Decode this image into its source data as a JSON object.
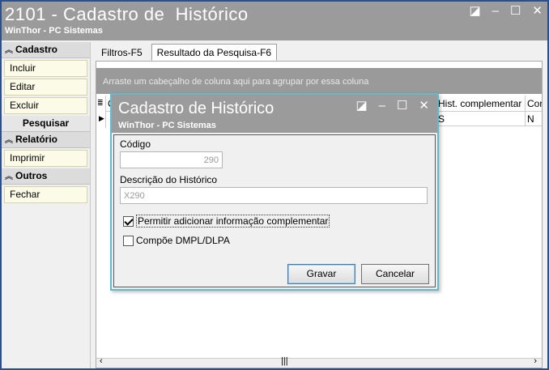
{
  "window": {
    "title": "2101 - Cadastro de  Histórico",
    "subtitle": "WinThor - PC Sistemas"
  },
  "sidebar": {
    "groups": [
      {
        "label": "Cadastro",
        "items": [
          "Incluir",
          "Editar",
          "Excluir"
        ]
      },
      {
        "label": "Pesquisar",
        "items": []
      },
      {
        "label": "Relatório",
        "items": [
          "Imprimir"
        ]
      },
      {
        "label": "Outros",
        "items": [
          "Fechar"
        ]
      }
    ]
  },
  "tabs": [
    "Filtros-F5",
    "Resultado da Pesquisa-F6"
  ],
  "grid": {
    "group_hint": "Arraste um cabeçalho de coluna aqui para agrupar por essa coluna",
    "columns": [
      "C",
      "Hist. complementar",
      "Cor"
    ],
    "row": [
      "",
      "S",
      "N"
    ]
  },
  "dialog": {
    "title": "Cadastro de Histórico",
    "subtitle": "WinThor - PC Sistemas",
    "codigo_label": "Código",
    "codigo_value": "290",
    "descricao_label": "Descrição do Histórico",
    "descricao_value": "X290",
    "chk_complementar": {
      "label": "Permitir adicionar informação complementar",
      "checked": true
    },
    "chk_dmpl": {
      "label": "Compõe DMPL/DLPA",
      "checked": false
    },
    "save_button": "Gravar",
    "cancel_button": "Cancelar"
  },
  "icons": {
    "restore": "restore-icon",
    "minimize": "minimize-icon",
    "maximize": "maximize-icon",
    "close": "close-icon"
  },
  "colors": {
    "titlebar": "#9b9b9b",
    "dialog_border": "#66b9c9",
    "sidebar_item_bg": "#fbfbe8"
  }
}
